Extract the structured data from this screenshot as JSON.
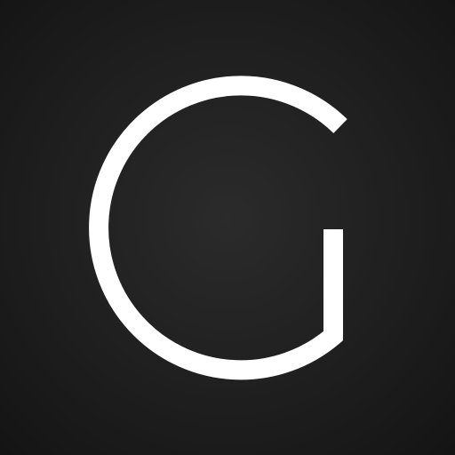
{
  "icon": {
    "name": "letter-g-logo-icon",
    "letter": "G",
    "colors": {
      "background_center": "#2b2b2b",
      "background_edge": "#141414",
      "glyph": "#ffffff"
    }
  }
}
